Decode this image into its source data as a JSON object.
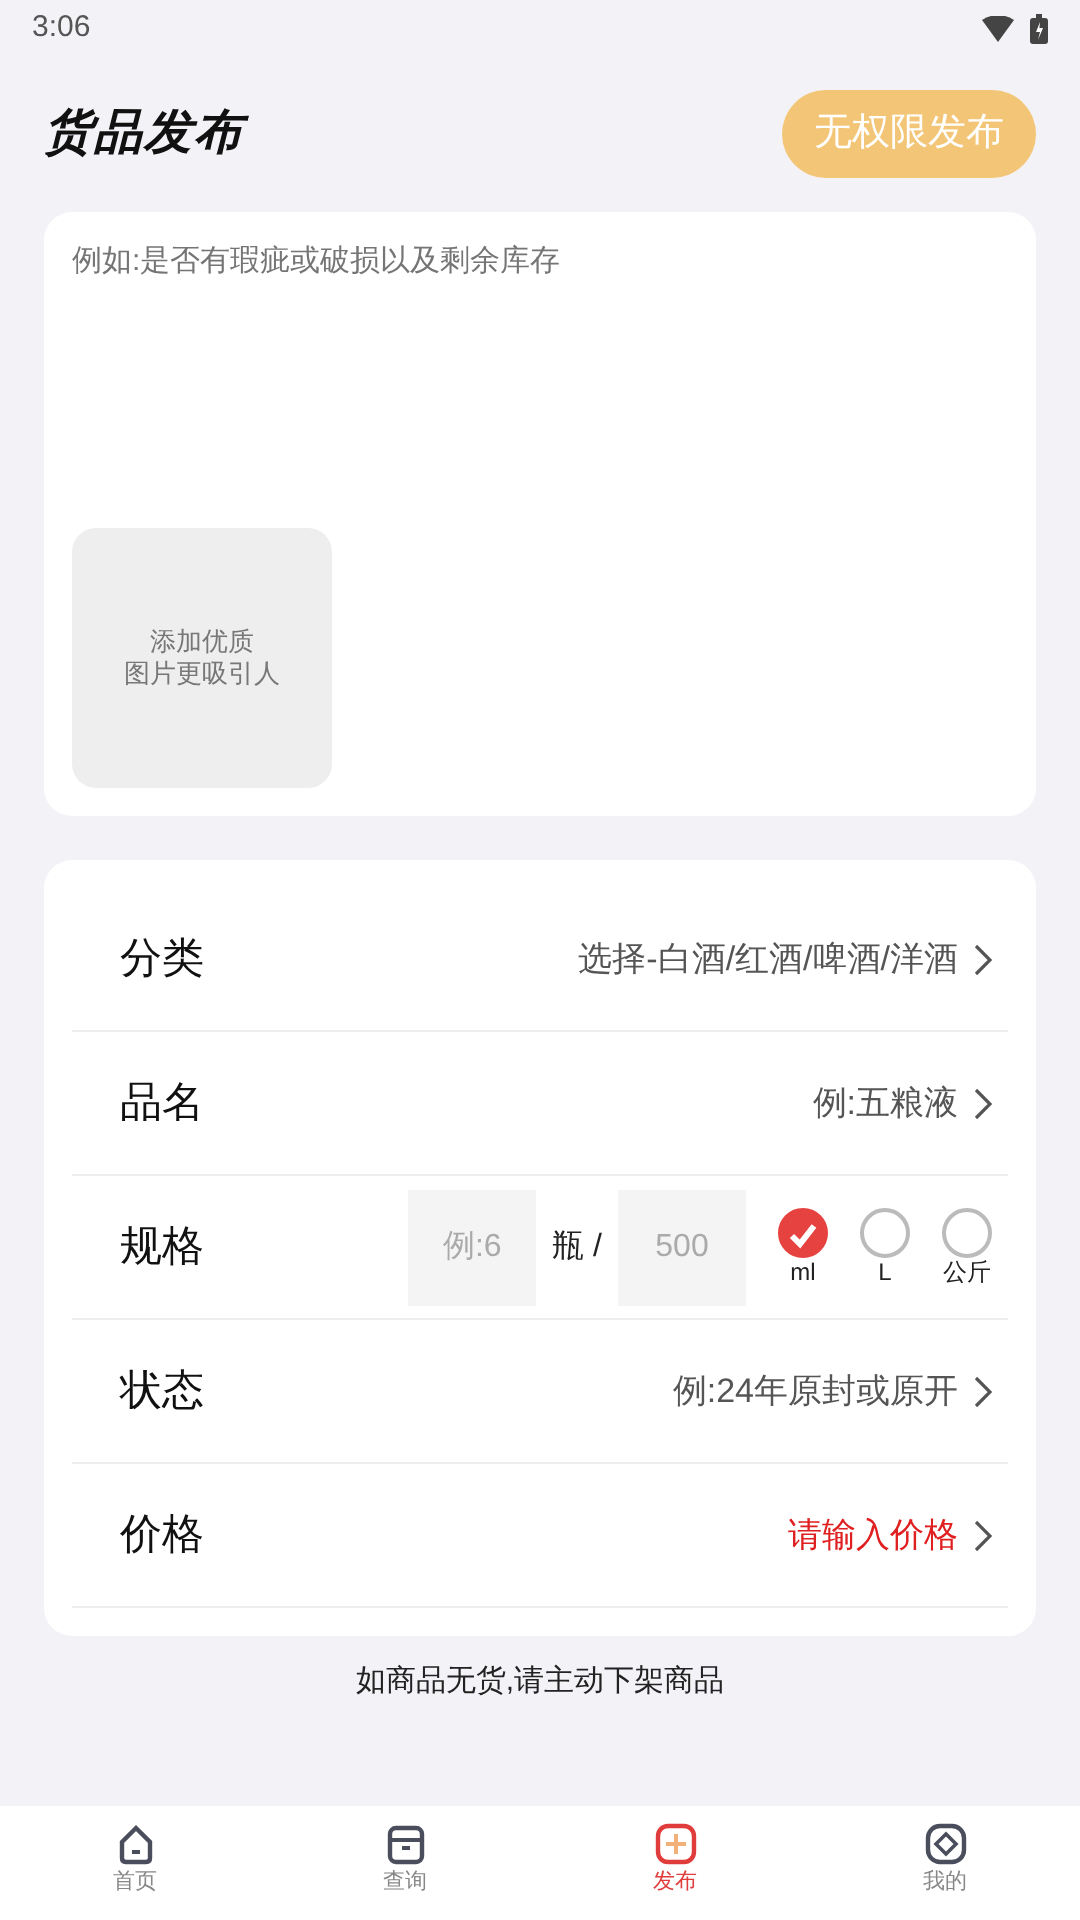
{
  "status_bar": {
    "time": "3:06"
  },
  "header": {
    "title": "货品发布",
    "action": "无权限发布",
    "action_disabled": true
  },
  "description": {
    "placeholder": "例如:是否有瑕疵或破损以及剩余库存",
    "upload_hint": [
      "添加优质",
      "图片更吸引人"
    ]
  },
  "fields": [
    {
      "kind": "select",
      "label": "分类",
      "value": "选择-白酒/红酒/啤酒/洋酒",
      "emphasis": false
    },
    {
      "kind": "select",
      "label": "品名",
      "value": "例:五粮液",
      "emphasis": false
    },
    {
      "kind": "spec",
      "label": "规格",
      "count_placeholder": "例:6",
      "count_unit": "瓶 /",
      "volume_placeholder": "500",
      "units": [
        {
          "label": "ml",
          "selected": true
        },
        {
          "label": "L",
          "selected": false
        },
        {
          "label": "公斤",
          "selected": false
        }
      ]
    },
    {
      "kind": "select",
      "label": "状态",
      "value": "例:24年原封或原开",
      "emphasis": false
    },
    {
      "kind": "select",
      "label": "价格",
      "value": "请输入价格",
      "emphasis": true
    }
  ],
  "note": "如商品无货,请主动下架商品",
  "tabs": [
    {
      "label": "首页",
      "selected": false
    },
    {
      "label": "查询",
      "selected": false
    },
    {
      "label": "发布",
      "selected": true
    },
    {
      "label": "我的",
      "selected": false
    }
  ]
}
